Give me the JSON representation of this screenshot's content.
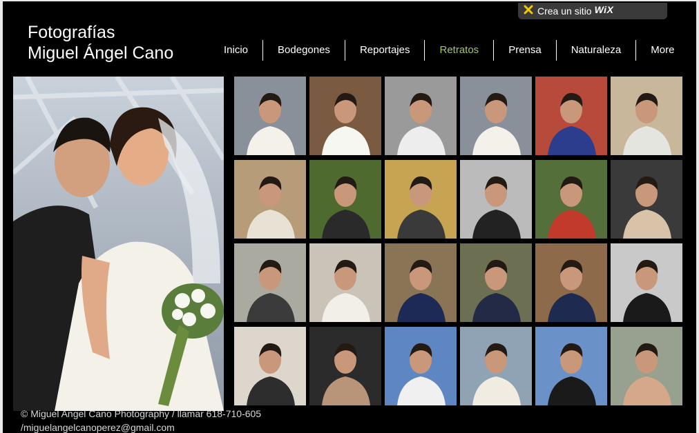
{
  "wix_bar": {
    "label": "Crea un sitio",
    "logo": "WiX"
  },
  "site": {
    "title_line1": "Fotografías",
    "title_line2": "Miguel Ángel Cano"
  },
  "nav": {
    "items": [
      {
        "label": "Inicio"
      },
      {
        "label": "Bodegones"
      },
      {
        "label": "Reportajes"
      },
      {
        "label": "Retratos",
        "active": true
      },
      {
        "label": "Prensa"
      },
      {
        "label": "Naturaleza"
      },
      {
        "label": "More"
      }
    ]
  },
  "colors": {
    "background": "#000000",
    "text": "#ffffff",
    "active_nav": "#a6c56b"
  },
  "thumbnails": [
    {
      "id": "wedding-couple-1",
      "tone": "#8a9099",
      "accent": "#f3f1ea"
    },
    {
      "id": "wedding-walk",
      "tone": "#7a5a40",
      "accent": "#f7f7f2"
    },
    {
      "id": "wedding-bw",
      "tone": "#9a9a9a",
      "accent": "#ededed"
    },
    {
      "id": "wedding-couple-2",
      "tone": "#8a9099",
      "accent": "#f3f1ea"
    },
    {
      "id": "man-colorful-wall",
      "tone": "#b74a3a",
      "accent": "#2b3d8c"
    },
    {
      "id": "man-sculpture",
      "tone": "#c8b79a",
      "accent": "#e5e5e0"
    },
    {
      "id": "man-standing-sphere",
      "tone": "#b79c79",
      "accent": "#e8e2d5"
    },
    {
      "id": "man-binoculars",
      "tone": "#4f6a2e",
      "accent": "#2a2a2a"
    },
    {
      "id": "man-columns",
      "tone": "#c7a452",
      "accent": "#3a3a3a"
    },
    {
      "id": "man-bw-glasses",
      "tone": "#bbbbbb",
      "accent": "#222222"
    },
    {
      "id": "man-magazine",
      "tone": "#556f3b",
      "accent": "#c23a2b"
    },
    {
      "id": "man-dark-portrait",
      "tone": "#3a3a3a",
      "accent": "#d8c3a8"
    },
    {
      "id": "film-sculpture",
      "tone": "#aaaaa0",
      "accent": "#3b3b3b"
    },
    {
      "id": "white-sphere",
      "tone": "#c9c3b8",
      "accent": "#f2efe9"
    },
    {
      "id": "man-blue-suit",
      "tone": "#8a7456",
      "accent": "#1c2a55"
    },
    {
      "id": "man-red-tie-1",
      "tone": "#6d6f53",
      "accent": "#222a45"
    },
    {
      "id": "man-red-tie-2",
      "tone": "#8c6a4a",
      "accent": "#1f2a50"
    },
    {
      "id": "man-white-wall",
      "tone": "#c9c9c9",
      "accent": "#1a1a1a"
    },
    {
      "id": "man-lying-white",
      "tone": "#dcd6cc",
      "accent": "#2d2d2d"
    },
    {
      "id": "man-close-dark",
      "tone": "#2b2b2b",
      "accent": "#b89478"
    },
    {
      "id": "man-white-horse",
      "tone": "#5d86c2",
      "accent": "#f0f0f0"
    },
    {
      "id": "man-horse-flag",
      "tone": "#8fa3b5",
      "accent": "#f1ece2"
    },
    {
      "id": "man-saddle",
      "tone": "#6a92c9",
      "accent": "#1a1a1a"
    },
    {
      "id": "man-closeup-grey",
      "tone": "#98a08f",
      "accent": "#d4a889"
    }
  ],
  "footer": {
    "line1": "© Miguel Angel Cano Photography / llamar 618-710-605",
    "line2": "/miguelangelcanoperez@gmail.com"
  }
}
